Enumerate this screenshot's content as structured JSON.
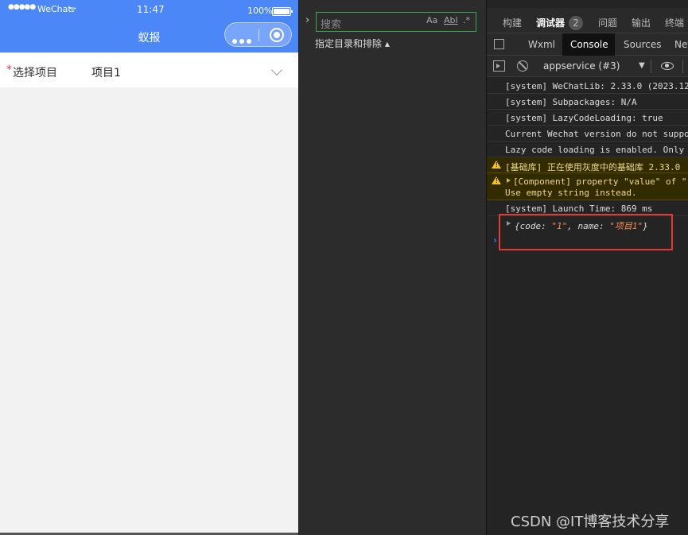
{
  "phone": {
    "status": {
      "signal": "●●●●●",
      "carrier": "WeChat",
      "wifi": "ᯤ",
      "time": "11:47",
      "battery": "100%"
    },
    "navbar": {
      "title": "蚁报"
    },
    "form": {
      "required_mark": "*",
      "label": "选择项目",
      "value": "项目1"
    }
  },
  "explorer": {
    "search_placeholder": "搜索",
    "match_case": "Aa",
    "whole_word": "Abl",
    "regex": ".*",
    "filter_label": "指定目录和排除 ▴"
  },
  "devtools": {
    "top_tabs": [
      "构建",
      "调试器",
      "问题",
      "输出",
      "终端"
    ],
    "active_top_tab": "调试器",
    "badge": "2",
    "sub_tabs": [
      "Wxml",
      "Console",
      "Sources",
      "Network"
    ],
    "active_sub_tab": "Console",
    "context": "appservice (#3)",
    "logs": [
      {
        "type": "info",
        "text": "[system] WeChatLib: 2.33.0 (2023.12"
      },
      {
        "type": "info",
        "text": "[system] Subpackages: N/A"
      },
      {
        "type": "info",
        "text": "[system] LazyCodeLoading: true"
      },
      {
        "type": "info",
        "text": "Current Wechat version do not suppo"
      },
      {
        "type": "info",
        "text": "Lazy code loading is enabled. Only"
      },
      {
        "type": "warn",
        "text": "[基础库] 正在使用灰度中的基础库 2.33.0"
      },
      {
        "type": "warn",
        "line1": "[Component] property \"value\" of \"r",
        "line2": "Use empty string instead."
      },
      {
        "type": "info",
        "text": "[system] Launch Time: 869 ms"
      }
    ],
    "object_log": {
      "open": "{",
      "key1": "code: ",
      "val1": "\"1\"",
      "comma": ", ",
      "key2": "name: ",
      "val2": "\"项目1\"",
      "close": "}"
    },
    "prompt": "›"
  },
  "watermark": "CSDN @IT博客技术分享",
  "colors": {
    "navbar": "#4b87f7",
    "highlight_box": "#e53935",
    "search_border": "#3fa54a"
  }
}
